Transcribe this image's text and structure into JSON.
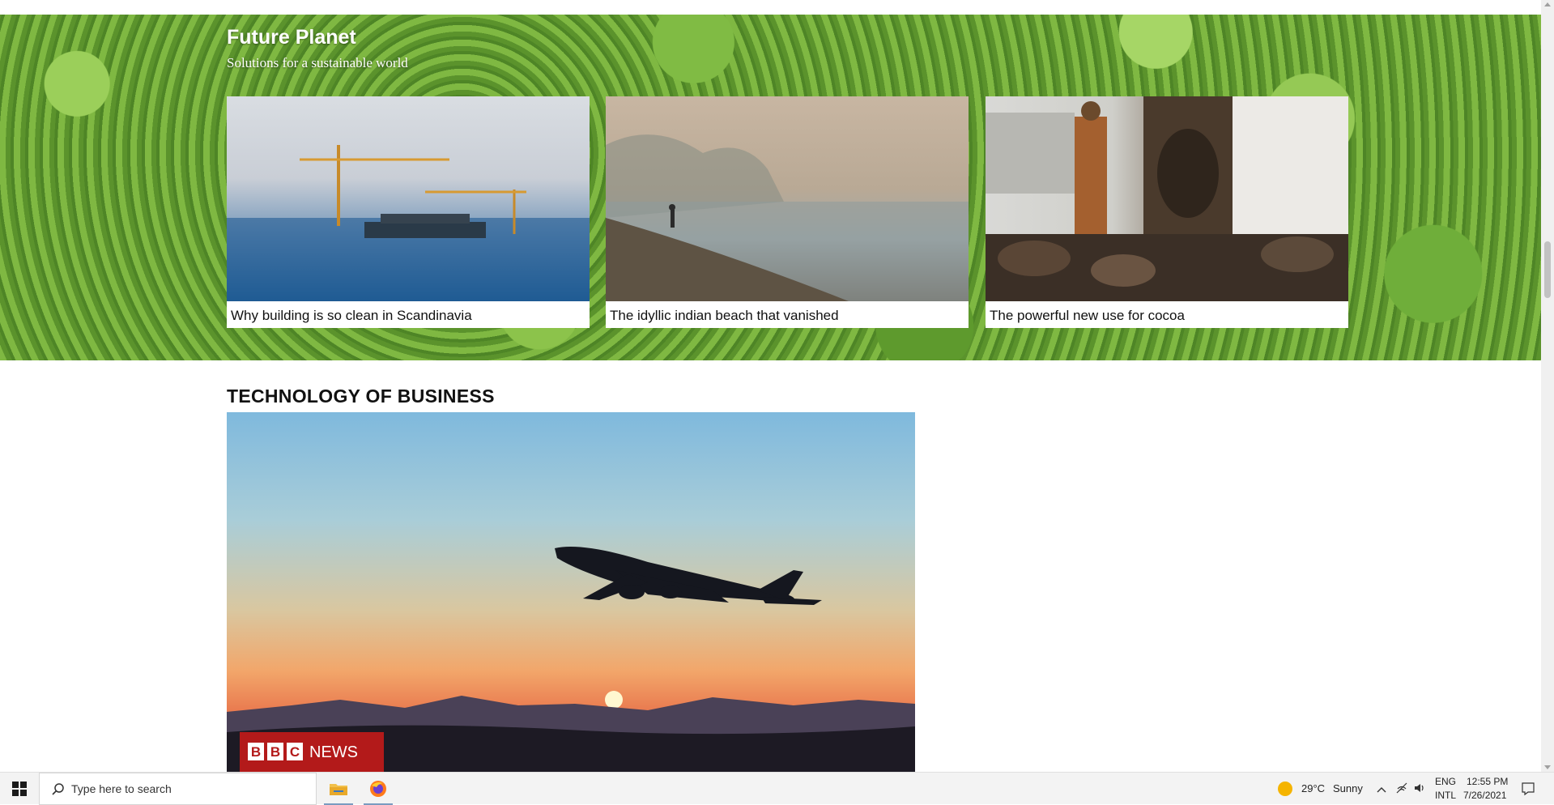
{
  "future_planet": {
    "title": "Future Planet",
    "subtitle": "Solutions for a sustainable world",
    "cards": [
      {
        "caption": "Why building is so clean in Scandinavia"
      },
      {
        "caption": "The idyllic indian beach that vanished"
      },
      {
        "caption": "The powerful new use for cocoa"
      }
    ]
  },
  "tech_business": {
    "title": "TECHNOLOGY OF BUSINESS",
    "badge_text": "BBC NEWS"
  },
  "taskbar": {
    "search_placeholder": "Type here to search",
    "weather_temp": "29°C",
    "weather_text": "Sunny",
    "lang_line1": "ENG",
    "lang_line2": "INTL",
    "time": "12:55 PM",
    "date": "7/26/2021"
  },
  "colors": {
    "badge_red": "#b31a1a",
    "banner_green": "#6aa535"
  }
}
